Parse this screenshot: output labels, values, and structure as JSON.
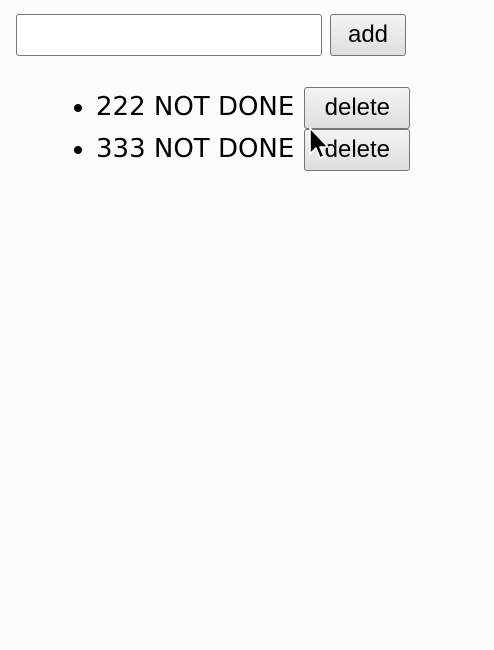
{
  "form": {
    "input_value": "",
    "input_placeholder": "",
    "add_label": "add"
  },
  "todos": [
    {
      "text": "222 NOT DONE",
      "delete_label": "delete"
    },
    {
      "text": "333 NOT DONE",
      "delete_label": "delete"
    }
  ],
  "icons": {
    "cursor": "mouse-pointer-icon"
  }
}
